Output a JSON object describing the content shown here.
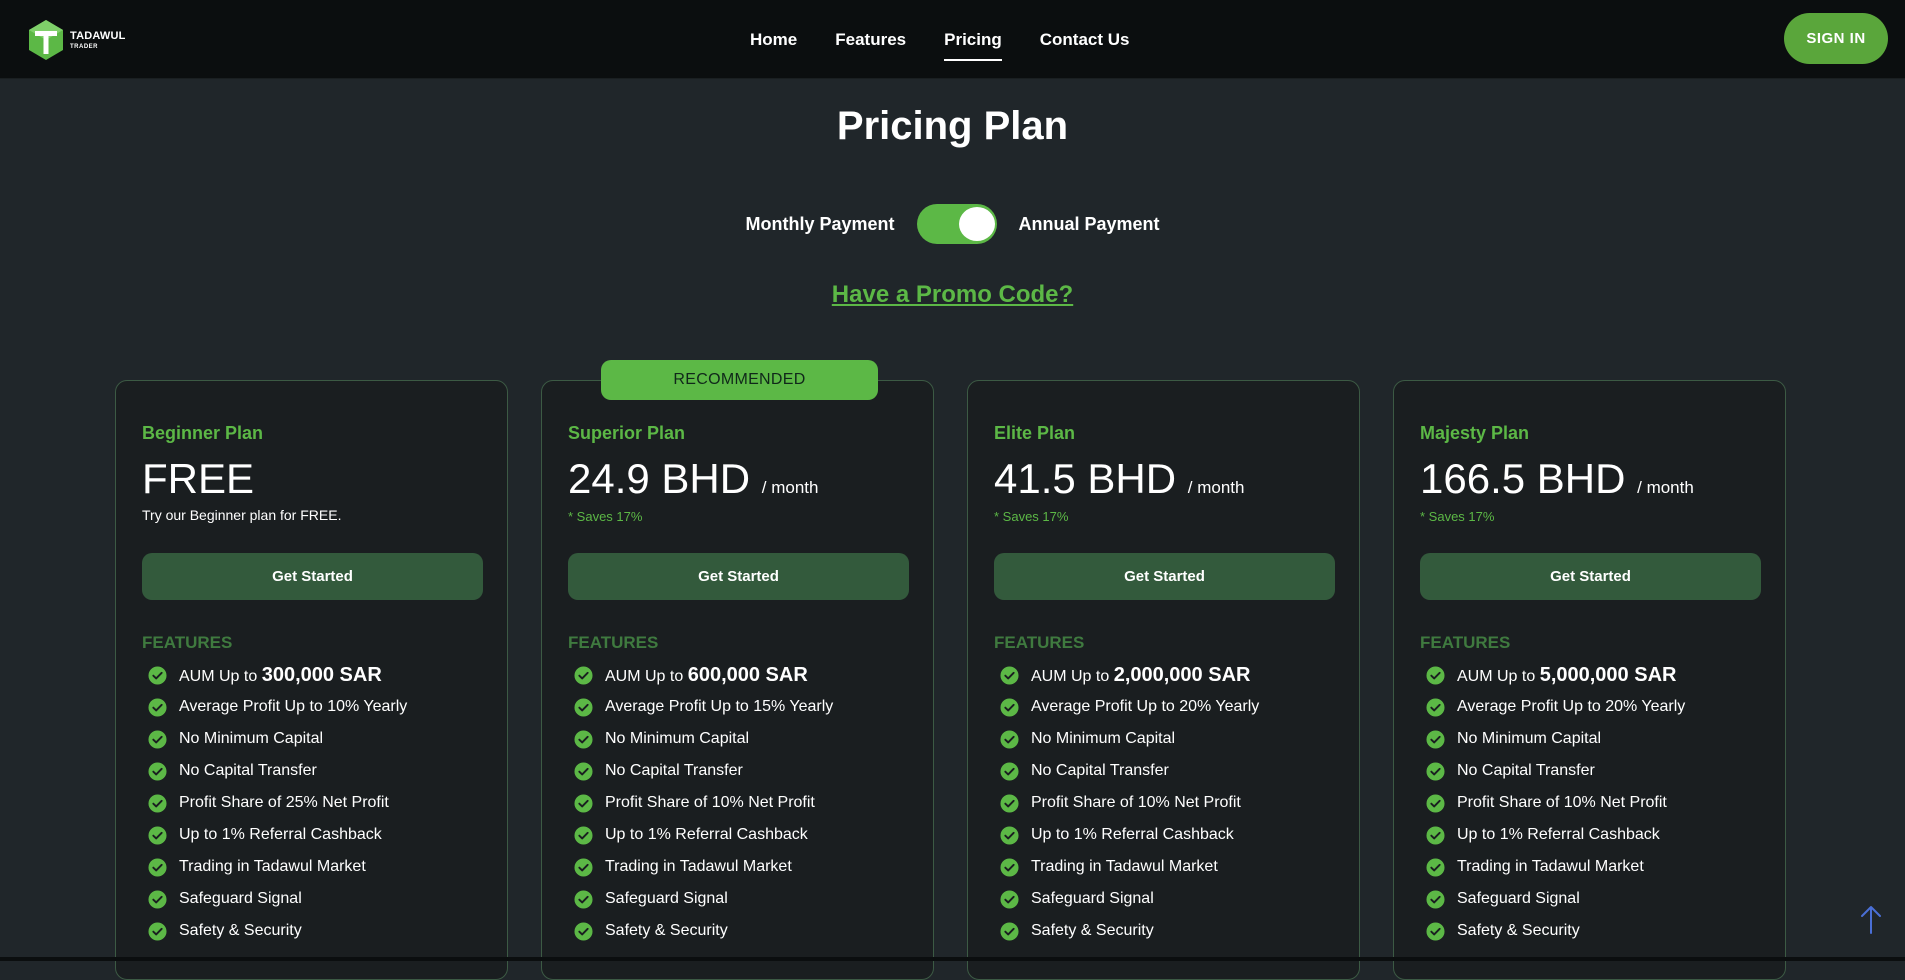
{
  "brand": {
    "line1": "TADAWUL",
    "line2": "TRADER"
  },
  "nav": {
    "links": [
      {
        "label": "Home",
        "active": false
      },
      {
        "label": "Features",
        "active": false
      },
      {
        "label": "Pricing",
        "active": true
      },
      {
        "label": "Contact Us",
        "active": false
      }
    ],
    "signin_label": "SIGN IN"
  },
  "page_title": "Pricing Plan",
  "billing": {
    "monthly_label": "Monthly Payment",
    "annual_label": "Annual Payment",
    "annual_selected": true
  },
  "promo_label": "Have a Promo Code?",
  "recommended_label": "RECOMMENDED",
  "plans": [
    {
      "name": "Beginner Plan",
      "price": "FREE",
      "period": "",
      "note": "Try our Beginner plan for FREE.",
      "cta": "Get Started",
      "features_label": "FEATURES",
      "aum_prefix": "AUM Up to",
      "aum_value": "300,000 SAR",
      "features": [
        "Average Profit Up to 10% Yearly",
        "No Minimum Capital",
        "No Capital Transfer",
        "Profit Share of 25% Net Profit",
        "Up to 1% Referral Cashback",
        "Trading in Tadawul Market",
        "Safeguard Signal",
        "Safety & Security"
      ]
    },
    {
      "name": "Superior Plan",
      "price": "24.9 BHD",
      "period": "/ month",
      "note": "* Saves 17%",
      "cta": "Get Started",
      "features_label": "FEATURES",
      "aum_prefix": "AUM Up to",
      "aum_value": "600,000 SAR",
      "features": [
        "Average Profit Up to 15% Yearly",
        "No Minimum Capital",
        "No Capital Transfer",
        "Profit Share of 10% Net Profit",
        "Up to 1% Referral Cashback",
        "Trading in Tadawul Market",
        "Safeguard Signal",
        "Safety & Security"
      ]
    },
    {
      "name": "Elite Plan",
      "price": "41.5 BHD",
      "period": "/ month",
      "note": "* Saves 17%",
      "cta": "Get Started",
      "features_label": "FEATURES",
      "aum_prefix": "AUM Up to",
      "aum_value": "2,000,000 SAR",
      "features": [
        "Average Profit Up to 20% Yearly",
        "No Minimum Capital",
        "No Capital Transfer",
        "Profit Share of 10% Net Profit",
        "Up to 1% Referral Cashback",
        "Trading in Tadawul Market",
        "Safeguard Signal",
        "Safety & Security"
      ]
    },
    {
      "name": "Majesty Plan",
      "price": "166.5 BHD",
      "period": "/ month",
      "note": "* Saves 17%",
      "cta": "Get Started",
      "features_label": "FEATURES",
      "aum_prefix": "AUM Up to",
      "aum_value": "5,000,000 SAR",
      "features": [
        "Average Profit Up to 20% Yearly",
        "No Minimum Capital",
        "No Capital Transfer",
        "Profit Share of 10% Net Profit",
        "Up to 1% Referral Cashback",
        "Trading in Tadawul Market",
        "Safeguard Signal",
        "Safety & Security"
      ]
    }
  ],
  "colors": {
    "accent": "#5cb846",
    "background": "#20262a",
    "navbar": "#0b0e0f",
    "card_border": "#3c5a44",
    "cta": "#335a3c"
  },
  "icons": {
    "feature": "check-circle-icon",
    "scroll_top": "arrow-up-icon",
    "logo": "tadawul-logo-icon"
  }
}
